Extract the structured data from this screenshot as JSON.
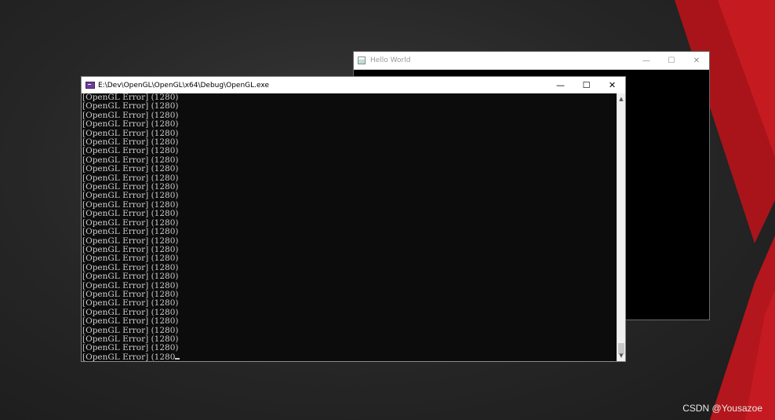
{
  "hello_window": {
    "title": "Hello World",
    "minimize": "—",
    "maximize": "☐",
    "close": "✕"
  },
  "console_window": {
    "title": "E:\\Dev\\OpenGL\\OpenGL\\x64\\Debug\\OpenGL.exe",
    "minimize": "—",
    "maximize": "☐",
    "close": "✕",
    "lines": [
      "[OpenGL Error] (1280)",
      "[OpenGL Error] (1280)",
      "[OpenGL Error] (1280)",
      "[OpenGL Error] (1280)",
      "[OpenGL Error] (1280)",
      "[OpenGL Error] (1280)",
      "[OpenGL Error] (1280)",
      "[OpenGL Error] (1280)",
      "[OpenGL Error] (1280)",
      "[OpenGL Error] (1280)",
      "[OpenGL Error] (1280)",
      "[OpenGL Error] (1280)",
      "[OpenGL Error] (1280)",
      "[OpenGL Error] (1280)",
      "[OpenGL Error] (1280)",
      "[OpenGL Error] (1280)",
      "[OpenGL Error] (1280)",
      "[OpenGL Error] (1280)",
      "[OpenGL Error] (1280)",
      "[OpenGL Error] (1280)",
      "[OpenGL Error] (1280)",
      "[OpenGL Error] (1280)",
      "[OpenGL Error] (1280)",
      "[OpenGL Error] (1280)",
      "[OpenGL Error] (1280)",
      "[OpenGL Error] (1280)",
      "[OpenGL Error] (1280)",
      "[OpenGL Error] (1280)",
      "[OpenGL Error] (1280)"
    ],
    "last_line": "[OpenGL Error] (1280"
  },
  "scrollbar": {
    "up": "▲",
    "down": "▼"
  },
  "watermark": "CSDN @Yousazoe",
  "colors": {
    "accent_red": "#c0141a",
    "console_bg": "#0c0c0c",
    "console_text": "#cccccc"
  }
}
